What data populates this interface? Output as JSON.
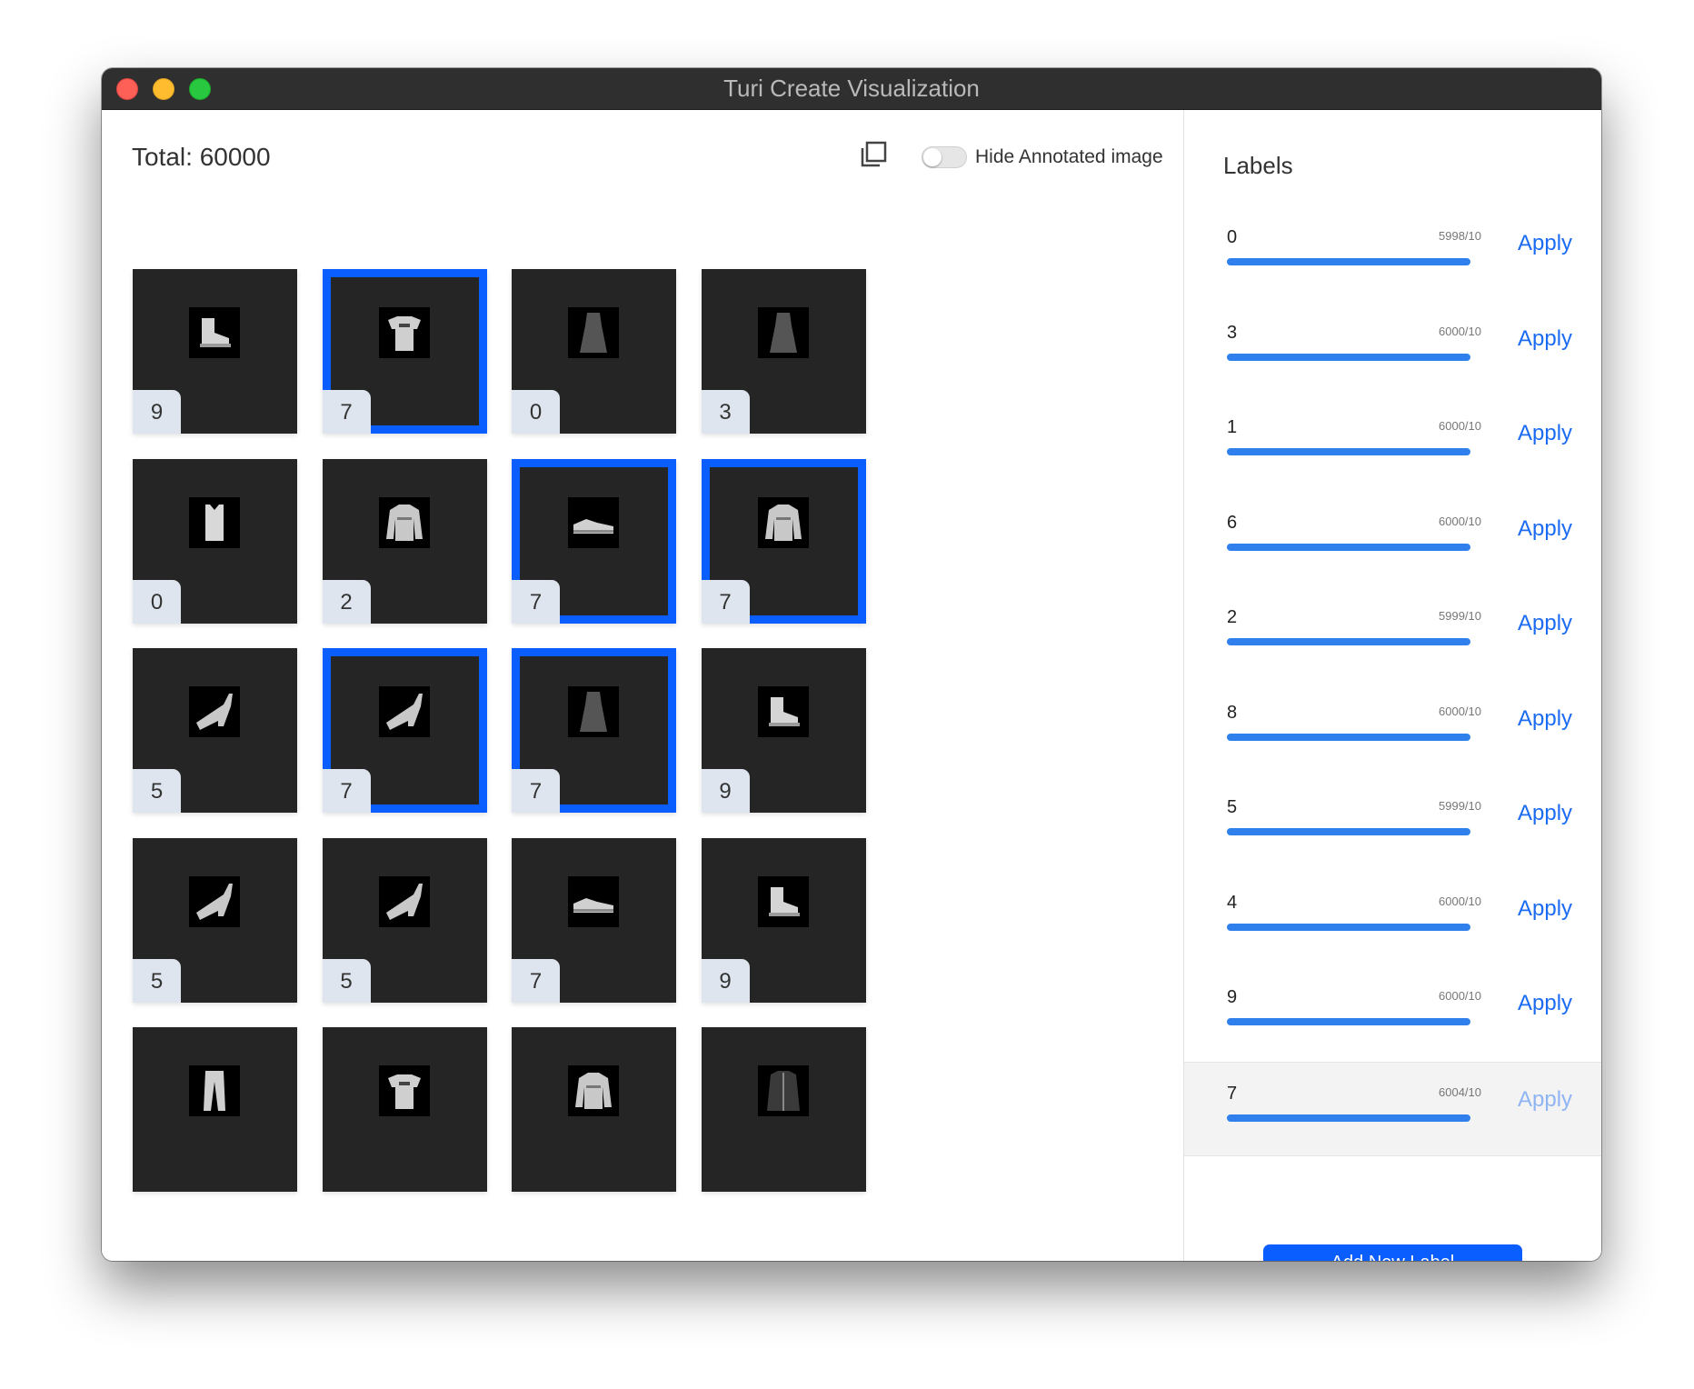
{
  "window": {
    "title": "Turi Create Visualization"
  },
  "header": {
    "total_text": "Total: 60000",
    "toggle_label": "Hide Annotated image",
    "toggle_on": false
  },
  "grid": {
    "rows": [
      [
        {
          "label": "9",
          "item": "ankle-boot",
          "selected": false
        },
        {
          "label": "7",
          "item": "t-shirt",
          "selected": true
        },
        {
          "label": "0",
          "item": "dress",
          "selected": false
        },
        {
          "label": "3",
          "item": "dress",
          "selected": false
        }
      ],
      [
        {
          "label": "0",
          "item": "top",
          "selected": false
        },
        {
          "label": "2",
          "item": "pullover",
          "selected": false
        },
        {
          "label": "7",
          "item": "sneaker",
          "selected": true
        },
        {
          "label": "7",
          "item": "pullover",
          "selected": true
        }
      ],
      [
        {
          "label": "5",
          "item": "sandal",
          "selected": false
        },
        {
          "label": "7",
          "item": "sandal",
          "selected": true
        },
        {
          "label": "7",
          "item": "dress",
          "selected": true
        },
        {
          "label": "9",
          "item": "ankle-boot",
          "selected": false
        }
      ],
      [
        {
          "label": "5",
          "item": "sandal",
          "selected": false
        },
        {
          "label": "5",
          "item": "sandal",
          "selected": false
        },
        {
          "label": "7",
          "item": "sneaker",
          "selected": false
        },
        {
          "label": "9",
          "item": "ankle-boot",
          "selected": false
        }
      ],
      [
        {
          "label": "",
          "item": "trouser",
          "selected": false
        },
        {
          "label": "",
          "item": "t-shirt",
          "selected": false
        },
        {
          "label": "",
          "item": "pullover",
          "selected": false
        },
        {
          "label": "",
          "item": "coat",
          "selected": false
        }
      ]
    ]
  },
  "sidebar": {
    "heading": "Labels",
    "apply_label": "Apply",
    "labels": [
      {
        "name": "0",
        "count": "5998/10",
        "fill": 1.0
      },
      {
        "name": "3",
        "count": "6000/10",
        "fill": 1.0
      },
      {
        "name": "1",
        "count": "6000/10",
        "fill": 1.0
      },
      {
        "name": "6",
        "count": "6000/10",
        "fill": 1.0
      },
      {
        "name": "2",
        "count": "5999/10",
        "fill": 1.0
      },
      {
        "name": "8",
        "count": "6000/10",
        "fill": 1.0
      },
      {
        "name": "5",
        "count": "5999/10",
        "fill": 1.0
      },
      {
        "name": "4",
        "count": "6000/10",
        "fill": 1.0
      },
      {
        "name": "9",
        "count": "6000/10",
        "fill": 1.0
      },
      {
        "name": "7",
        "count": "6004/10",
        "fill": 1.0
      }
    ],
    "add_label_button": "Add New Label"
  },
  "colors": {
    "accent": "#0a5eff",
    "bar": "#2f80ed",
    "apply_link": "#1b6cf2",
    "titlebar": "#2f2f2f",
    "tile_bg": "#252525"
  }
}
